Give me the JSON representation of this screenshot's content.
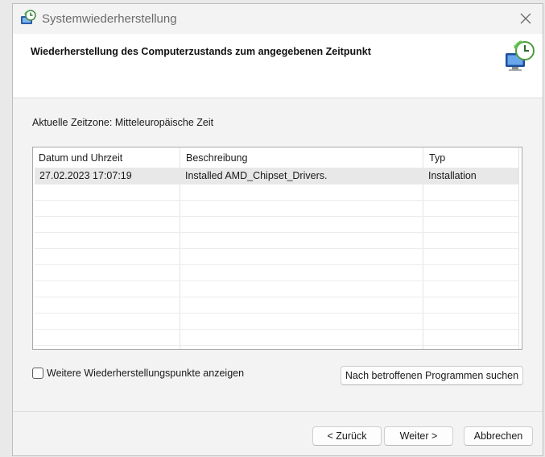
{
  "window": {
    "title": "Systemwiederherstellung",
    "header_title": "Wiederherstellung des Computerzustands zum angegebenen Zeitpunkt"
  },
  "timezone_label": "Aktuelle Zeitzone: Mitteleuropäische Zeit",
  "table": {
    "columns": [
      "Datum und Uhrzeit",
      "Beschreibung",
      "Typ"
    ],
    "sorted_column": "Datum und Uhrzeit",
    "rows": [
      [
        "27.02.2023 17:07:19",
        "Installed AMD_Chipset_Drivers.",
        "Installation"
      ]
    ]
  },
  "checkbox": {
    "label": "Weitere Wiederherstellungspunkte anzeigen",
    "checked": false
  },
  "buttons": {
    "scan": "Nach betroffenen Programmen suchen",
    "back": "< Zurück",
    "next": "Weiter >",
    "cancel": "Abbrechen"
  },
  "icons": {
    "app": "system-restore-icon",
    "header": "system-restore-computer-icon",
    "close": "close-icon"
  }
}
